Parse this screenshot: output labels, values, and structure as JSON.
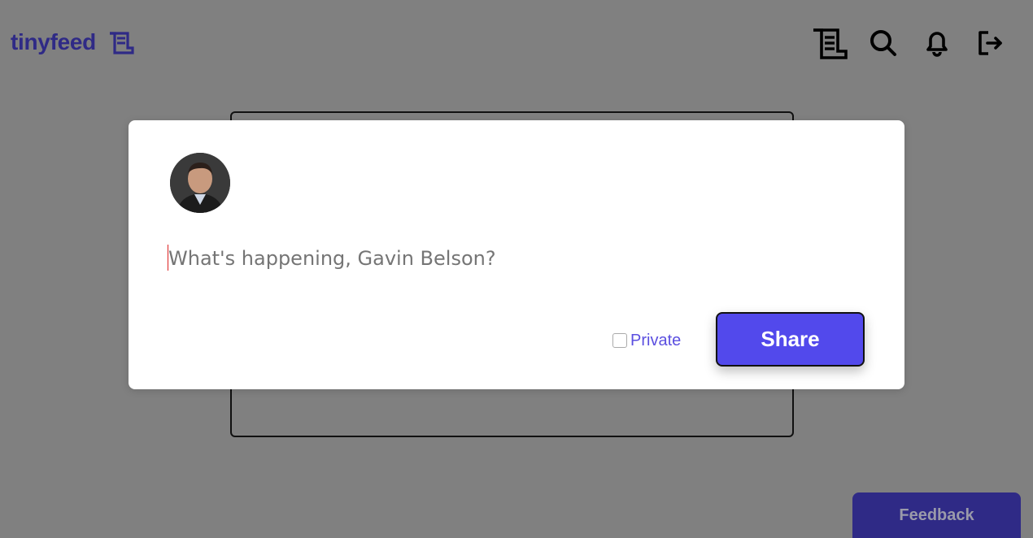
{
  "brand": {
    "name": "tinyfeed",
    "logo_icon": "scroll-icon",
    "color": "#2f2a86"
  },
  "nav": {
    "icons": [
      "scroll-icon",
      "search-icon",
      "bell-icon",
      "logout-icon"
    ]
  },
  "composer": {
    "placeholder": "What's happening, Gavin Belson?",
    "value": "",
    "private_label": "Private",
    "private_checked": false,
    "share_label": "Share",
    "accent": "#5249ec"
  },
  "feedback": {
    "label": "Feedback"
  },
  "colors": {
    "overlay": "#808080",
    "modal": "#ffffff"
  }
}
